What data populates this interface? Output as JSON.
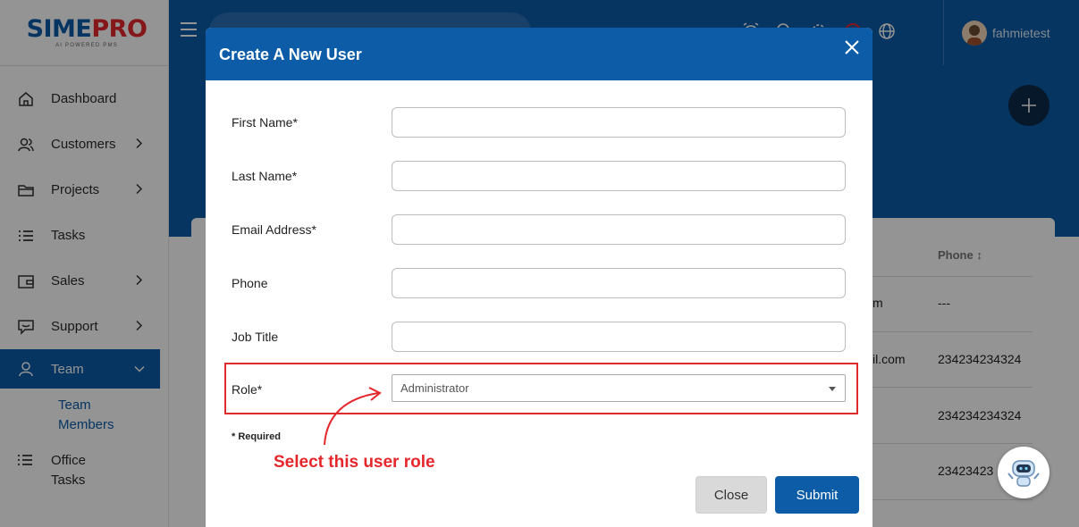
{
  "brand": {
    "logo_part1": "SIME",
    "logo_part2": "PRO",
    "tagline": "AI POWERED PMS"
  },
  "sidebar": {
    "items": [
      {
        "label": "Dashboard",
        "icon": "home-icon"
      },
      {
        "label": "Customers",
        "icon": "users-icon"
      },
      {
        "label": "Projects",
        "icon": "folder-icon"
      },
      {
        "label": "Tasks",
        "icon": "list-icon"
      },
      {
        "label": "Sales",
        "icon": "wallet-icon"
      },
      {
        "label": "Support",
        "icon": "chat-icon"
      },
      {
        "label": "Team",
        "icon": "user-icon"
      }
    ],
    "team_sub_item": "Team Members",
    "office_tasks": "Office Tasks"
  },
  "header": {
    "username": "fahmietest"
  },
  "background_table": {
    "column_phone": "Phone ↕",
    "cells": [
      {
        "email_fragment": "m",
        "phone": "---"
      },
      {
        "email_fragment": "il.com",
        "phone": "234234234324"
      },
      {
        "email_fragment": "",
        "phone": "234234234324"
      },
      {
        "email_fragment": "",
        "phone": "23423423"
      }
    ]
  },
  "modal": {
    "title": "Create A New User",
    "fields": [
      {
        "label": "First Name*",
        "value": ""
      },
      {
        "label": "Last Name*",
        "value": ""
      },
      {
        "label": "Email Address*",
        "value": ""
      },
      {
        "label": "Phone",
        "value": ""
      },
      {
        "label": "Job Title",
        "value": ""
      }
    ],
    "role_label": "Role*",
    "role_value": "Administrator",
    "required_note": "* Required",
    "close_label": "Close",
    "submit_label": "Submit"
  },
  "annotation": {
    "text": "Select this user role",
    "color": "#e5262b"
  },
  "colors": {
    "primary": "#0d5ca8",
    "accent": "#e5262b"
  }
}
